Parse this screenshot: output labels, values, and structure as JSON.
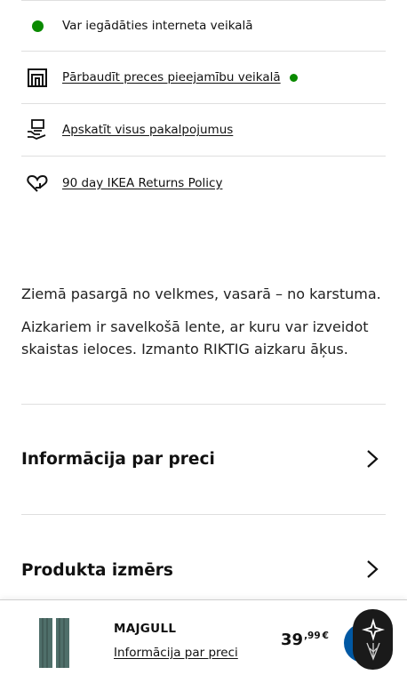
{
  "info_rows": [
    {
      "icon": "green-dot-icon",
      "text": "Var iegādāties interneta veikalā"
    },
    {
      "icon": "store-icon",
      "text": "Pārbaudīt preces pieejamību veikalā",
      "status_color": "#0a8a00"
    },
    {
      "icon": "services-icon",
      "text": "Apskatīt visus pakalpojumus"
    },
    {
      "icon": "returns-heart-icon",
      "text": "90 day IKEA Returns Policy"
    }
  ],
  "description": [
    "Ziemā pasargā no velkmes, vasarā – no karstuma.",
    "Aizkariem ir savelkošā lente, ar kuru var izveidot skaistas ieloces. Izmanto RIKTIG aizkaru āķus."
  ],
  "accordions": [
    {
      "title": "Informācija par preci",
      "icon": "chevron-right-icon"
    },
    {
      "title": "Produkta izmērs",
      "icon": "chevron-right-icon"
    }
  ],
  "bottom_bar": {
    "product_name": "MAJGULL",
    "product_link": "Informācija par preci",
    "price_int": "39",
    "price_dec": ",99",
    "price_currency": "€",
    "cart_icon": "cart-button-icon",
    "badge_icon": "sparkle-badge-icon"
  },
  "colors": {
    "accent_blue": "#0058a3",
    "available_green": "#0a8a00",
    "curtain": "#4f6f6a"
  }
}
